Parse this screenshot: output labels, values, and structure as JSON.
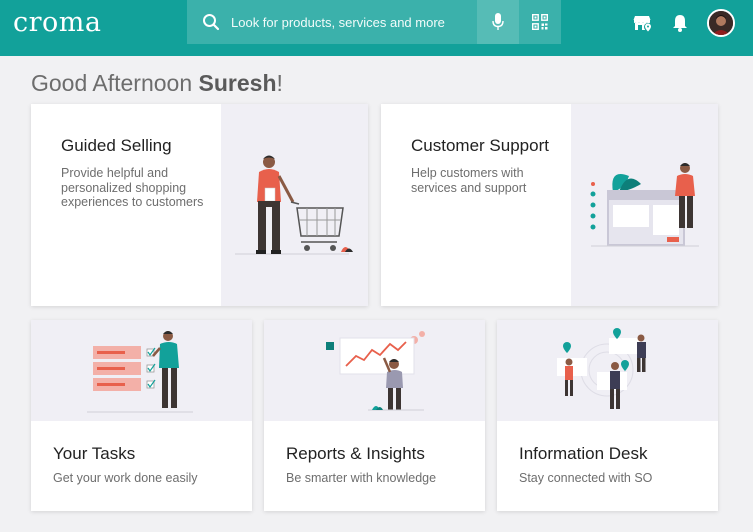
{
  "header": {
    "logo": "croma",
    "search_placeholder": "Look for products, services and more",
    "colors": {
      "primary": "#12a19a",
      "search_bg": "#3bb1ab"
    },
    "icons": [
      "search-icon",
      "microphone-icon",
      "qr-code-icon",
      "store-locator-icon",
      "bell-icon",
      "user-avatar"
    ]
  },
  "greeting": {
    "prefix": "Good Afternoon ",
    "name": "Suresh",
    "suffix": "!"
  },
  "cards": {
    "guided_selling": {
      "title": "Guided Selling",
      "description": "Provide helpful and personalized shopping experiences to customers"
    },
    "customer_support": {
      "title": "Customer Support",
      "description": "Help customers with services and support"
    },
    "your_tasks": {
      "title": "Your Tasks",
      "description": "Get your work done easily"
    },
    "reports": {
      "title": "Reports & Insights",
      "description": "Be smarter with knowledge"
    },
    "info_desk": {
      "title": "Information Desk",
      "description": "Stay connected with SO"
    }
  }
}
